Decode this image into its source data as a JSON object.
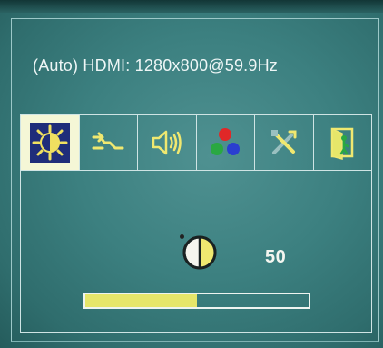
{
  "status": {
    "source_text": "(Auto) HDMI: 1280x800@59.9Hz"
  },
  "menu": {
    "tabs": [
      {
        "icon": "brightness-contrast-icon",
        "active": true
      },
      {
        "icon": "input-source-icon",
        "active": false
      },
      {
        "icon": "speaker-icon",
        "active": false
      },
      {
        "icon": "color-icon",
        "active": false
      },
      {
        "icon": "tools-icon",
        "active": false
      },
      {
        "icon": "exit-icon",
        "active": false
      }
    ]
  },
  "panel": {
    "setting_icon": "contrast-icon",
    "value": "50",
    "level_fraction": 0.5
  },
  "colors": {
    "accent_yellow": "#e6e66a",
    "active_tab_bg": "#f5f7d6",
    "active_icon_bg": "#1f2d7a",
    "osd_bg": "#3c8080"
  }
}
